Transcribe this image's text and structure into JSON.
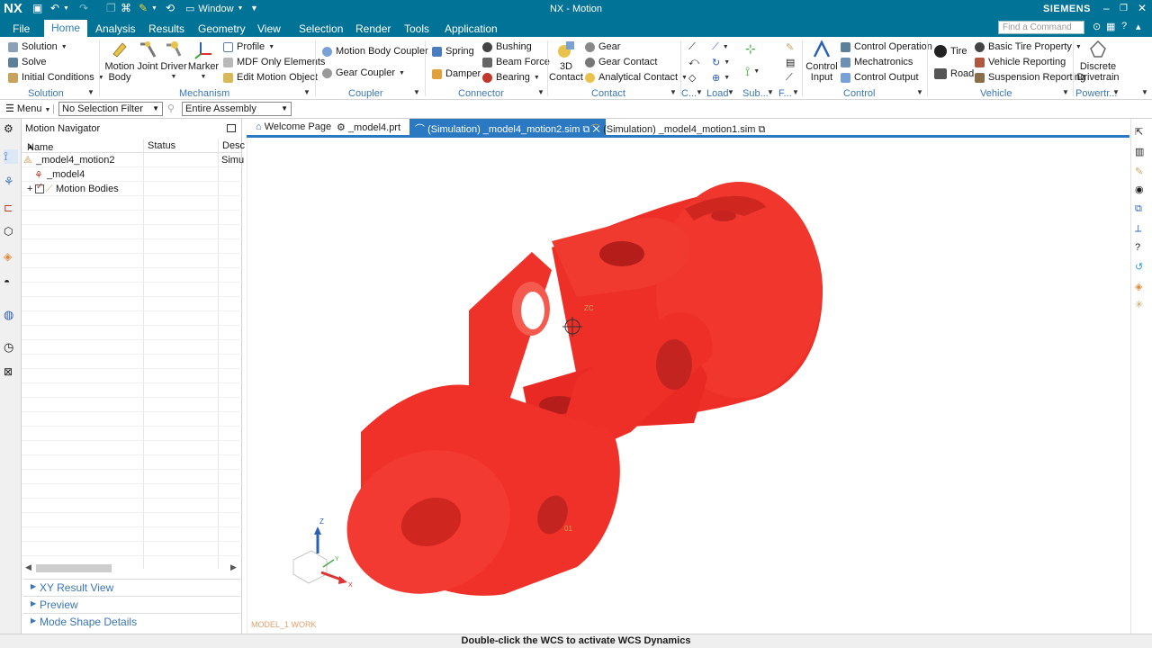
{
  "app": {
    "logo": "NX",
    "title": "NX - Motion",
    "brand": "SIEMENS",
    "window_menu": "Window"
  },
  "menu_tabs": [
    "File",
    "Home",
    "Analysis",
    "Results",
    "Geometry",
    "View",
    "Selection",
    "Render",
    "Tools",
    "Application"
  ],
  "active_tab": "Home",
  "search": {
    "placeholder": "Find a Command"
  },
  "ribbon": {
    "solution": {
      "label": "Solution",
      "items": [
        "Solution",
        "Solve",
        "Initial Conditions"
      ]
    },
    "mechanism": {
      "label": "Mechanism",
      "big": [
        "Motion Body",
        "Joint",
        "Driver",
        "Marker"
      ],
      "items": [
        "Profile",
        "MDF Only Elements",
        "Edit Motion Object"
      ]
    },
    "coupler": {
      "label": "Coupler",
      "items": [
        "Motion Body Coupler",
        "Gear Coupler"
      ]
    },
    "connector": {
      "label": "Connector",
      "items": [
        "Spring",
        "Damper",
        "Bushing",
        "Beam Force",
        "Bearing"
      ]
    },
    "contact": {
      "label": "Contact",
      "big": "3D Contact",
      "items": [
        "Gear",
        "Gear Contact",
        "Analytical Contact"
      ]
    },
    "c_group": {
      "label": "C..."
    },
    "load": {
      "label": "Load"
    },
    "sub": {
      "label": "Sub..."
    },
    "f_group": {
      "label": "F..."
    },
    "control": {
      "label": "Control",
      "big": "Control Input",
      "items": [
        "Control Operation",
        "Mechatronics",
        "Control Output"
      ]
    },
    "vehicle": {
      "label": "Vehicle",
      "items": [
        "Tire",
        "Road",
        "Basic Tire Property",
        "Vehicle Reporting",
        "Suspension Reporting"
      ]
    },
    "powertrain": {
      "label": "Powertr...",
      "big": "Discrete Drivetrain"
    }
  },
  "toolbar2": {
    "menu": "Menu",
    "selection_filter": "No Selection Filter",
    "scope": "Entire Assembly"
  },
  "navigator": {
    "title": "Motion Navigator",
    "columns": [
      "Name",
      "Status",
      "Desc"
    ],
    "rows": [
      {
        "name": "_model4_motion2",
        "status": "",
        "desc": "Simu"
      },
      {
        "name": "_model4",
        "status": "",
        "desc": ""
      },
      {
        "name": "Motion Bodies",
        "status": "",
        "desc": ""
      }
    ],
    "panels": [
      "XY Result View",
      "Preview",
      "Mode Shape Details"
    ]
  },
  "doc_tabs": [
    {
      "label": "Welcome Page",
      "active": false
    },
    {
      "label": "_model4.prt",
      "active": false
    },
    {
      "label": "(Simulation) _model4_motion2.sim",
      "active": true
    },
    {
      "label": "(Simulation) _model4_motion1.sim",
      "active": false
    }
  ],
  "viewport": {
    "work_label": "MODEL_1 WORK",
    "zc_label": "ZC",
    "triad": {
      "z": "Z",
      "y": "Y",
      "x": "X"
    },
    "part_label": "01",
    "part_color": "#f0312a"
  },
  "status_text": "Double-click the WCS to activate WCS Dynamics",
  "colors": {
    "accent": "#007396",
    "tab_active": "#2b79c2"
  }
}
